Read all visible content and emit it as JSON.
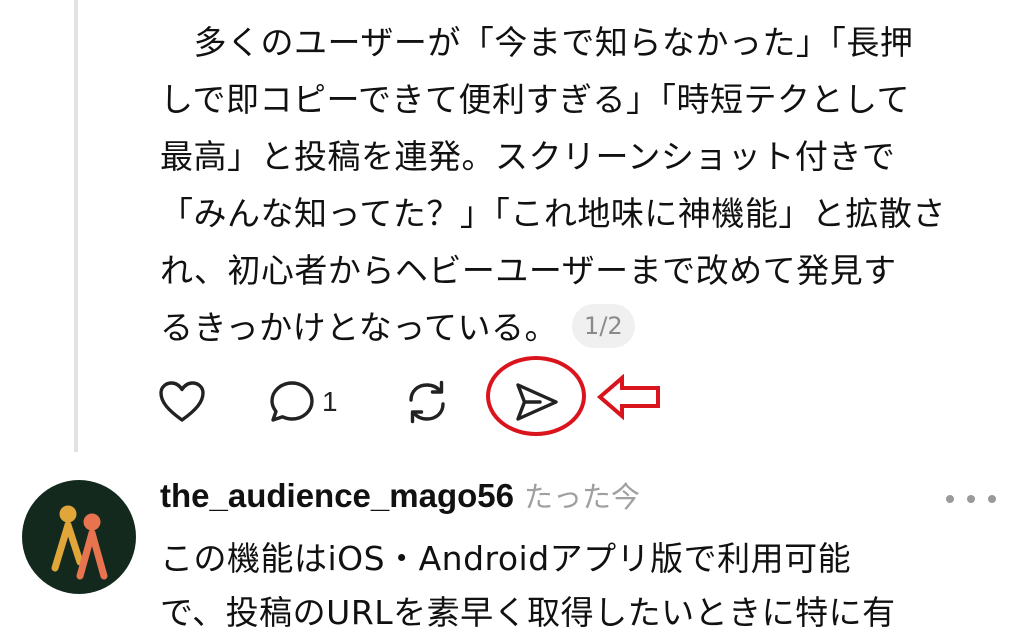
{
  "post": {
    "lines": [
      "　多くのユーザーが「今まで知らなかった」「長押",
      "しで即コピーできて便利すぎる」「時短テクとして",
      "最高」と投稿を連発。スクリーンショット付きで",
      "「みんな知ってた？」「これ地味に神機能」と拡散さ",
      "れ、初心者からヘビーユーザーまで改めて発見す",
      "るきっかけとなっている。"
    ],
    "page_indicator": "1/2"
  },
  "actions": {
    "like_icon": "heart-icon",
    "reply_icon": "speech-bubble-icon",
    "reply_count": "1",
    "repost_icon": "repost-icon",
    "share_icon": "send-icon"
  },
  "annotation": {
    "color": "#d9141c"
  },
  "reply": {
    "username": "the_audience_mago56",
    "timestamp": "たった今",
    "lines": [
      "この機能はiOS・Androidアプリ版で利用可能",
      "で、投稿のURLを素早く取得したいときに特に有"
    ],
    "avatar_colors": {
      "background": "#14291e",
      "figure_left": "#e0a63a",
      "figure_right": "#e8734f"
    }
  }
}
